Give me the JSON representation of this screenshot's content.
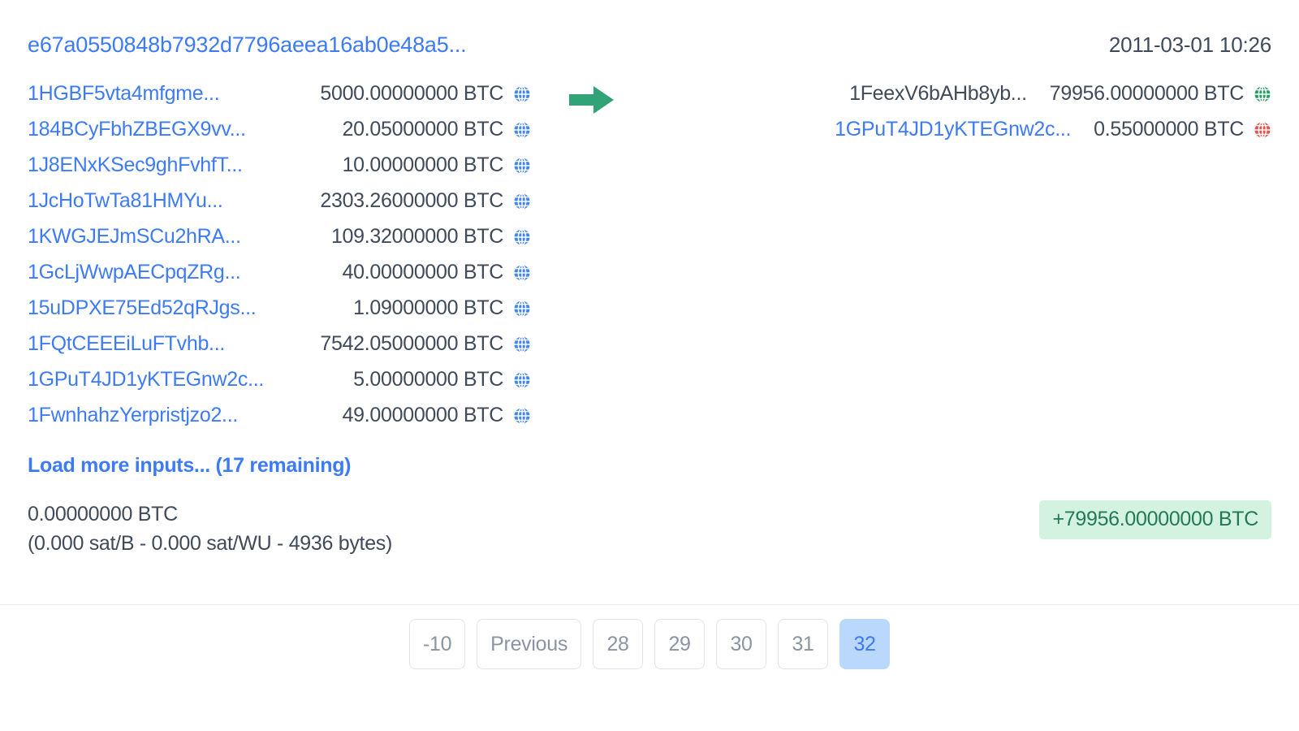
{
  "transaction": {
    "hash": "e67a0550848b7932d7796aeea16ab0e48a5...",
    "timestamp": "2011-03-01 10:26",
    "arrow_icon": "right-arrow-icon",
    "arrow_color": "#32a377"
  },
  "inputs": {
    "globe_icon": "globe-icon",
    "globe_color": "#4285f4",
    "rows": [
      {
        "address": "1HGBF5vta4mfgme...",
        "amount": "5000.00000000 BTC",
        "is_link": true
      },
      {
        "address": "184BCyFbhZBEGX9vv...",
        "amount": "20.05000000 BTC",
        "is_link": true
      },
      {
        "address": "1J8ENxKSec9ghFvhfT...",
        "amount": "10.00000000 BTC",
        "is_link": true
      },
      {
        "address": "1JcHoTwTa81HMYu...",
        "amount": "2303.26000000 BTC",
        "is_link": true
      },
      {
        "address": "1KWGJEJmSCu2hRA...",
        "amount": "109.32000000 BTC",
        "is_link": true
      },
      {
        "address": "1GcLjWwpAECpqZRg...",
        "amount": "40.00000000 BTC",
        "is_link": true
      },
      {
        "address": "15uDPXE75Ed52qRJgs...",
        "amount": "1.09000000 BTC",
        "is_link": true
      },
      {
        "address": "1FQtCEEEiLuFTvhb...",
        "amount": "7542.05000000 BTC",
        "is_link": true
      },
      {
        "address": "1GPuT4JD1yKTEGnw2c...",
        "amount": "5.00000000 BTC",
        "is_link": true
      },
      {
        "address": "1FwnhahzYerpristjzo2...",
        "amount": "49.00000000 BTC",
        "is_link": true
      }
    ],
    "load_more_label": "Load more inputs... (17 remaining)"
  },
  "outputs": {
    "rows": [
      {
        "address": "1FeexV6bAHb8yb...",
        "amount": "79956.00000000 BTC",
        "is_link": false,
        "globe_icon": "globe-icon",
        "globe_color": "#2a9d63"
      },
      {
        "address": "1GPuT4JD1yKTEGnw2c...",
        "amount": "0.55000000 BTC",
        "is_link": true,
        "globe_icon": "globe-icon",
        "globe_color": "#e8534a"
      }
    ]
  },
  "footer": {
    "fee_amount": "0.00000000 BTC",
    "fee_details": "(0.000 sat/B - 0.000 sat/WU - 4936 bytes)",
    "total_badge": "+79956.00000000 BTC",
    "badge_bg": "#d3f2e0",
    "badge_text_color": "#227a52"
  },
  "pagination": {
    "buttons": [
      {
        "label": "-10",
        "active": false
      },
      {
        "label": "Previous",
        "active": false
      },
      {
        "label": "28",
        "active": false
      },
      {
        "label": "29",
        "active": false
      },
      {
        "label": "30",
        "active": false
      },
      {
        "label": "31",
        "active": false
      },
      {
        "label": "32",
        "active": true
      }
    ]
  }
}
